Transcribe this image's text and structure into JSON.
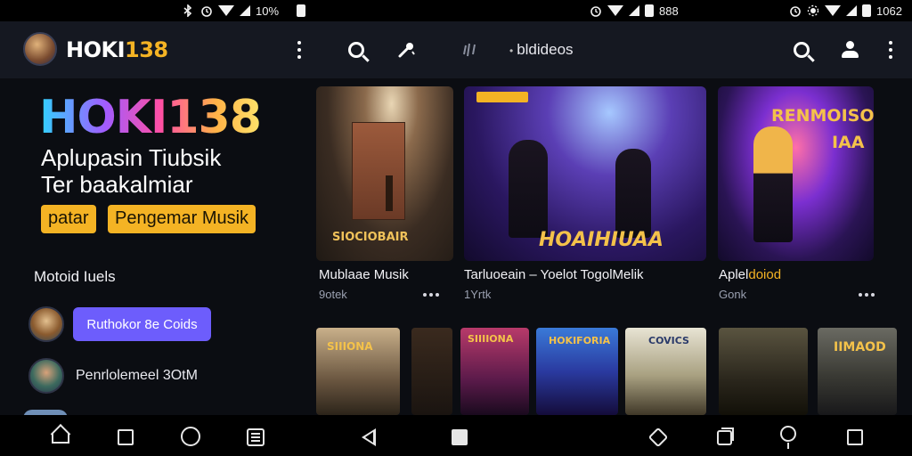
{
  "status_bar": {
    "left_text": "10%",
    "middle_text": "888",
    "right_text": "1062"
  },
  "app_bar": {
    "brand_white": "HOKI",
    "brand_yellow": "138",
    "search_text": "bldideos"
  },
  "hero": {
    "title": "HOKI138",
    "subtitle_line1": "Aplupasin Tiubsik",
    "subtitle_line2": "Ter baakalmiar",
    "chip1": "patar",
    "chip2": "Pengemar Musik"
  },
  "sidebar": {
    "section_title": "Motoid Iuels",
    "pill_label": "Ruthokor 8e Coids",
    "row_text": "Penrlolemeel 3OtM"
  },
  "cards": [
    {
      "title": "Mublaae Musik",
      "meta": "9otek",
      "banner": "SIOCIOBAIR"
    },
    {
      "title": "Tarluoeain – Yoelot TogolMelik",
      "meta": "1Yrtk",
      "banner": "HOAIHIUAA",
      "tag": ""
    },
    {
      "title_white": "Aplel",
      "title_yellow": "doiod",
      "meta": "Gonk",
      "banner_line1": "RENMOISO",
      "banner_line2": "IAA"
    }
  ],
  "thumbnails": [
    {
      "label": "SIIIONA"
    },
    {
      "label": ""
    },
    {
      "label": "SIIIIONA"
    },
    {
      "label": "HOKIFORIA"
    },
    {
      "label": "COVICS"
    },
    {
      "label": ""
    },
    {
      "label": "IIMAOD"
    }
  ],
  "colors": {
    "accent_yellow": "#f4b324",
    "accent_purple": "#6d5dfc",
    "background": "#0b0d12",
    "appbar": "#151821"
  },
  "icons": [
    "bluetooth-icon",
    "alarm-icon",
    "wifi-icon",
    "signal-icon",
    "battery-icon",
    "menu-kebab-icon",
    "search-icon",
    "mic-icon",
    "cast-icon",
    "search-alt-icon",
    "user-icon",
    "more-icon",
    "home-icon",
    "recents-icon",
    "circle-home-icon",
    "list-icon",
    "back-icon",
    "square-icon",
    "diamond-icon",
    "pin-icon",
    "overview-icon"
  ]
}
